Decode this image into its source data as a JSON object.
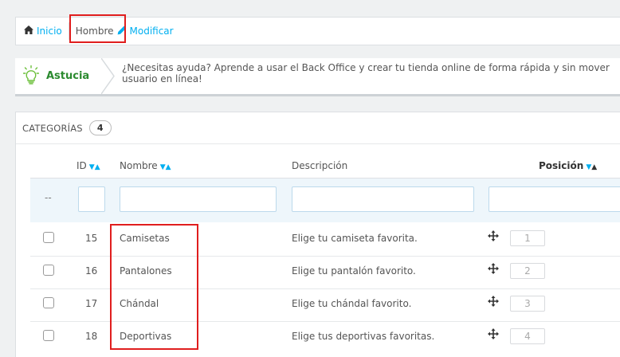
{
  "breadcrumb": {
    "home_label": "Inicio",
    "current_label": "Hombre",
    "edit_label": "Modificar"
  },
  "tip": {
    "label": "Astucia",
    "line1": "¿Necesitas ayuda? Aprende a usar el Back Office y crear tu tienda online de forma rápida y sin mover",
    "line2": "usuario en línea!"
  },
  "panel": {
    "title": "CATEGORÍAS",
    "count": "4"
  },
  "table": {
    "columns": {
      "id": "ID",
      "name": "Nombre",
      "description": "Descripción",
      "position": "Posición"
    },
    "filter_placeholder": "--",
    "rows": [
      {
        "id": "15",
        "name": "Camisetas",
        "description": "Elige tu camiseta favorita.",
        "position": "1"
      },
      {
        "id": "16",
        "name": "Pantalones",
        "description": "Elige tu pantalón favorito.",
        "position": "2"
      },
      {
        "id": "17",
        "name": "Chándal",
        "description": "Elige tu chándal favorito.",
        "position": "3"
      },
      {
        "id": "18",
        "name": "Deportivas",
        "description": "Elige tus deportivas favoritas.",
        "position": "4"
      }
    ]
  },
  "colors": {
    "accent": "#00aff0",
    "tip_green": "#2b8a2f",
    "highlight_red": "#e01e1e"
  }
}
